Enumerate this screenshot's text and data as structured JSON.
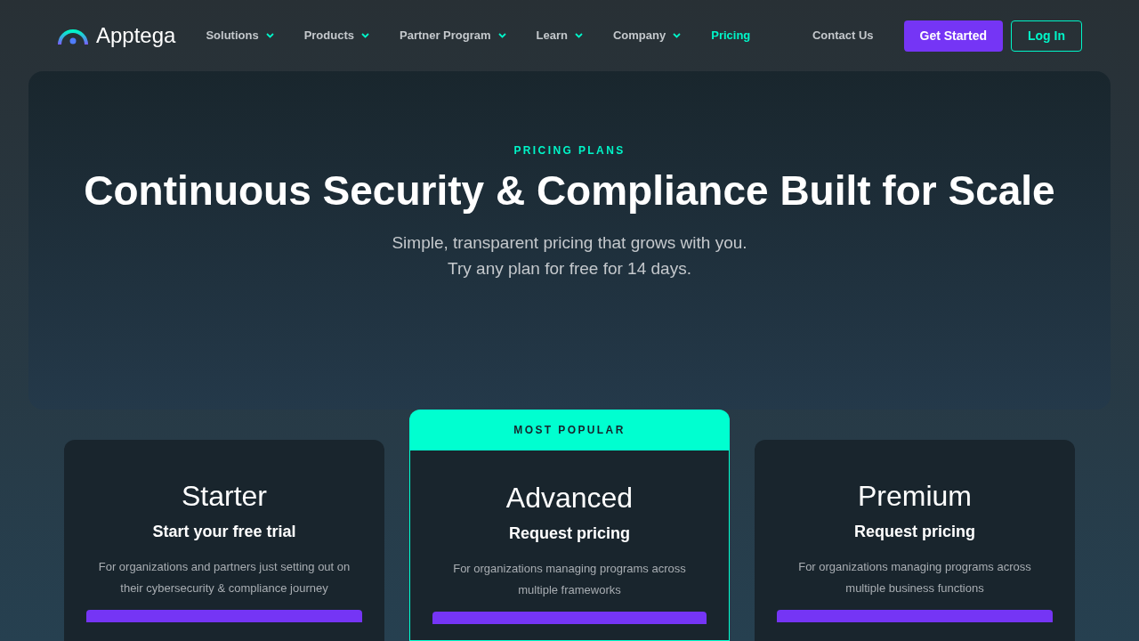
{
  "logo": {
    "text": "Apptega"
  },
  "nav": [
    {
      "label": "Solutions",
      "dropdown": true,
      "selected": false
    },
    {
      "label": "Products",
      "dropdown": true,
      "selected": false
    },
    {
      "label": "Partner Program",
      "dropdown": true,
      "selected": false
    },
    {
      "label": "Learn",
      "dropdown": true,
      "selected": false
    },
    {
      "label": "Company",
      "dropdown": true,
      "selected": false
    },
    {
      "label": "Pricing",
      "dropdown": false,
      "selected": true
    },
    {
      "label": "Contact Us",
      "dropdown": false,
      "selected": false
    }
  ],
  "actions": [
    {
      "label": "Get Started",
      "kind": "primary"
    },
    {
      "label": "Log In",
      "kind": "outline"
    }
  ],
  "hero": {
    "eyebrow": "PRICING PLANS",
    "title": "Continuous Security & Compliance Built for Scale",
    "subtitle_lines": [
      "Simple, transparent pricing that grows with you.",
      "Try any plan for free for 14 days."
    ]
  },
  "plans": [
    {
      "name": "Starter",
      "subtitle": "Start your free trial",
      "description": "For organizations and partners just setting out on their cybersecurity & compliance journey",
      "featured": false
    },
    {
      "name": "Advanced",
      "subtitle": "Request pricing",
      "description": "For organizations managing programs across multiple frameworks",
      "featured": true,
      "badge": "MOST POPULAR"
    },
    {
      "name": "Premium",
      "subtitle": "Request pricing",
      "description": "For organizations managing programs across multiple business functions",
      "featured": false
    }
  ]
}
